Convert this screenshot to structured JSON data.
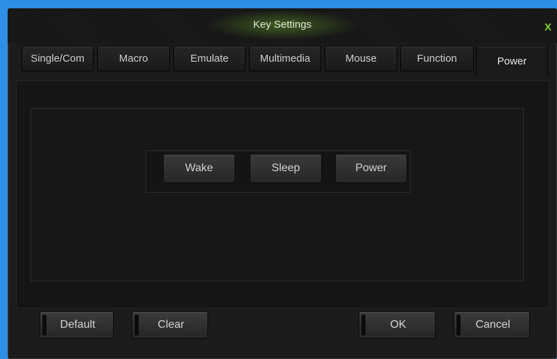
{
  "window": {
    "title": "Key Settings",
    "close_label": "X"
  },
  "tabs": [
    {
      "label": "Single/Com"
    },
    {
      "label": "Macro"
    },
    {
      "label": "Emulate"
    },
    {
      "label": "Multimedia"
    },
    {
      "label": "Mouse"
    },
    {
      "label": "Function"
    },
    {
      "label": "Power",
      "active": true
    }
  ],
  "power_options": [
    {
      "label": "Wake"
    },
    {
      "label": "Sleep"
    },
    {
      "label": "Power"
    }
  ],
  "footer": {
    "default_label": "Default",
    "clear_label": "Clear",
    "ok_label": "OK",
    "cancel_label": "Cancel"
  },
  "colors": {
    "accent": "#7ed321",
    "desktop": "#2f8fe6",
    "dialog_bg": "#1b1b1b"
  }
}
